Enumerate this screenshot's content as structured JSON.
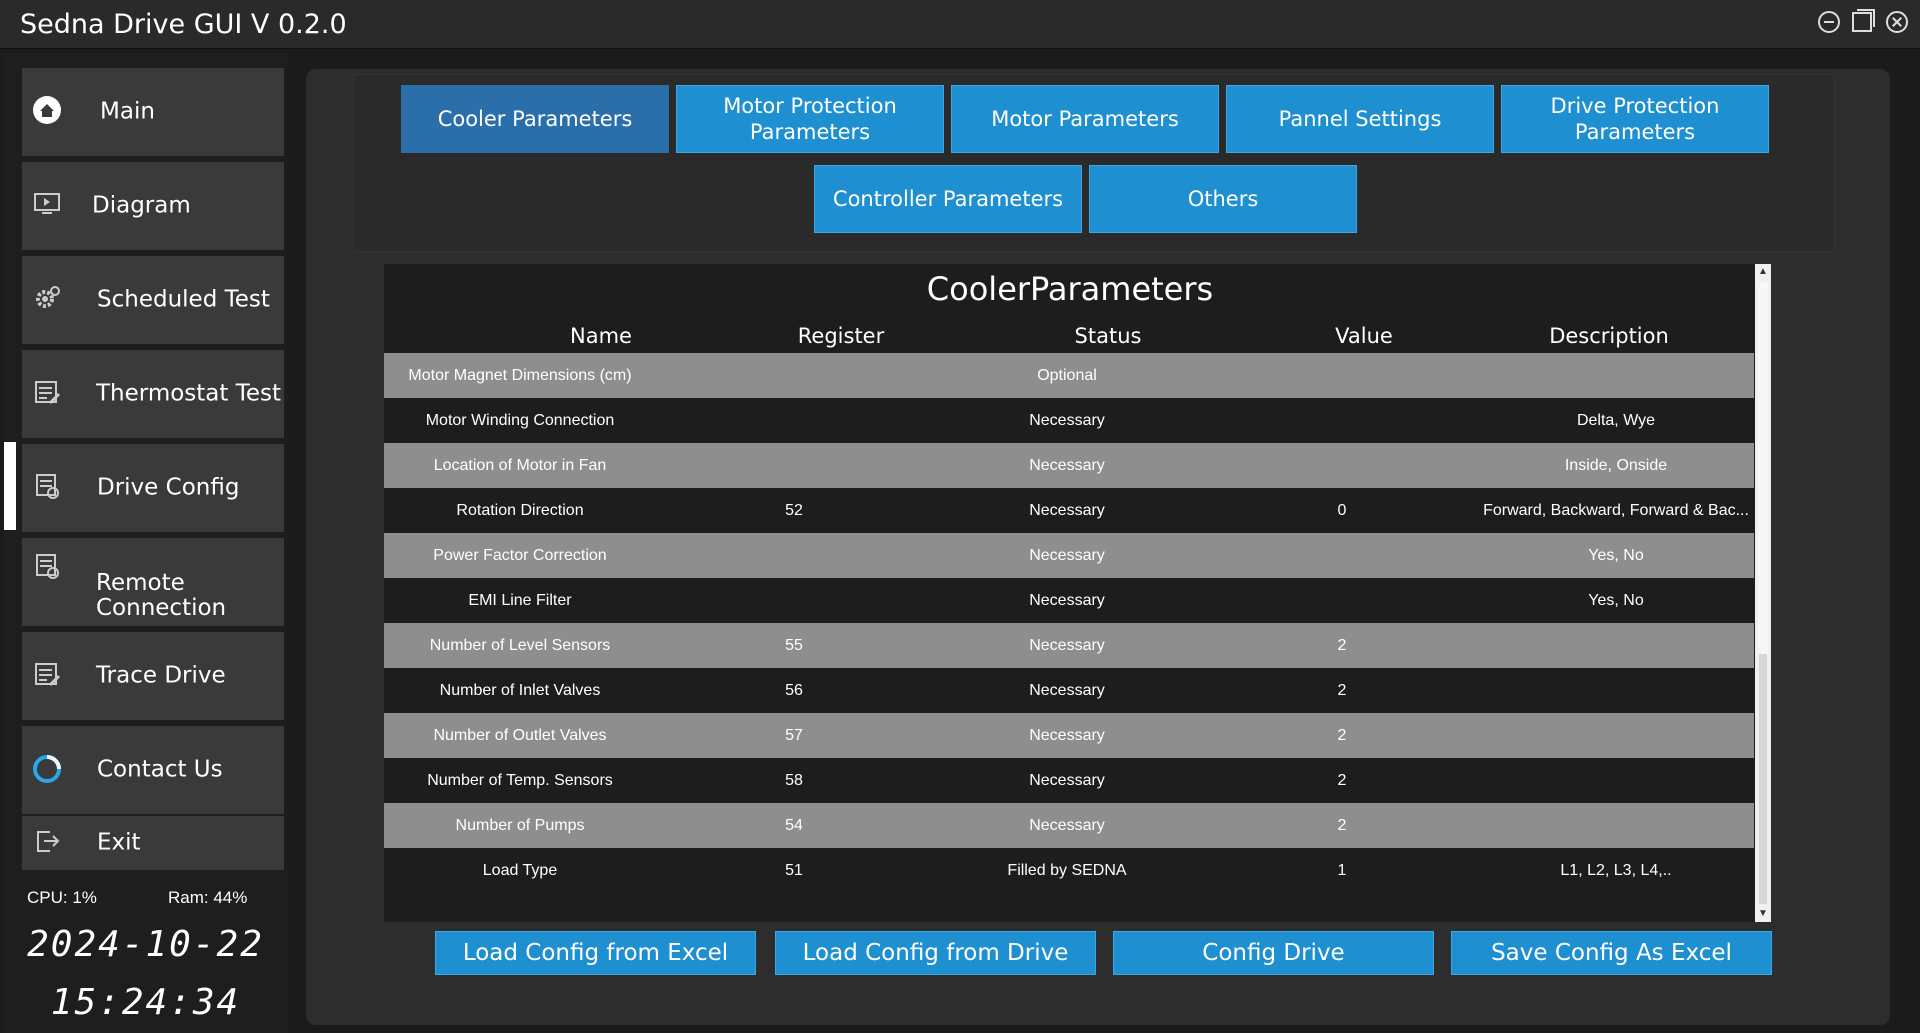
{
  "window": {
    "title": "Sedna Drive GUI V 0.2.0",
    "controls": [
      "minimize-icon",
      "restore-icon",
      "close-icon"
    ]
  },
  "sidebar": {
    "items": [
      {
        "label": "Main",
        "icon": "home-icon"
      },
      {
        "label": "Diagram",
        "icon": "monitor-icon"
      },
      {
        "label": "Scheduled Test",
        "icon": "gear-icon"
      },
      {
        "label": "Thermostat  Test",
        "icon": "test-board-icon"
      },
      {
        "label": "Drive Config",
        "icon": "config-icon",
        "active": true
      },
      {
        "label": "Remote Connection",
        "icon": "remote-icon"
      },
      {
        "label": "Trace Drive",
        "icon": "trace-icon"
      },
      {
        "label": "Contact Us",
        "icon": "contact-ring-icon"
      },
      {
        "label": "Exit",
        "icon": "exit-icon"
      }
    ],
    "cpu": "CPU: 1%",
    "ram": "Ram: 44%",
    "date": "2024-10-22",
    "time": "15:24:34"
  },
  "tabs": [
    {
      "label": "Cooler Parameters",
      "selected": true
    },
    {
      "label": "Motor Protection Parameters"
    },
    {
      "label": "Motor Parameters"
    },
    {
      "label": "Pannel Settings"
    },
    {
      "label": "Drive Protection Parameters"
    },
    {
      "label": "Controller Parameters"
    },
    {
      "label": "Others"
    }
  ],
  "table": {
    "title": "CoolerParameters",
    "headers": {
      "name": "Name",
      "register": "Register",
      "status": "Status",
      "value": "Value",
      "description": "Description"
    },
    "rows": [
      {
        "name": "Motor Magnet Dimensions (cm)",
        "register": "",
        "status": "Optional",
        "value": "",
        "description": ""
      },
      {
        "name": "Motor Winding Connection",
        "register": "",
        "status": "Necessary",
        "value": "",
        "description": "Delta, Wye"
      },
      {
        "name": "Location of Motor in Fan",
        "register": "",
        "status": "Necessary",
        "value": "",
        "description": "Inside, Onside"
      },
      {
        "name": "Rotation Direction",
        "register": "52",
        "status": "Necessary",
        "value": "0",
        "description": "Forward, Backward, Forward & Bac..."
      },
      {
        "name": "Power Factor Correction",
        "register": "",
        "status": "Necessary",
        "value": "",
        "description": "Yes, No"
      },
      {
        "name": "EMI Line Filter",
        "register": "",
        "status": "Necessary",
        "value": "",
        "description": "Yes, No"
      },
      {
        "name": "Number of Level Sensors",
        "register": "55",
        "status": "Necessary",
        "value": "2",
        "description": ""
      },
      {
        "name": "Number of Inlet Valves",
        "register": "56",
        "status": "Necessary",
        "value": "2",
        "description": ""
      },
      {
        "name": "Number of Outlet Valves",
        "register": "57",
        "status": "Necessary",
        "value": "2",
        "description": ""
      },
      {
        "name": "Number of Temp. Sensors",
        "register": "58",
        "status": "Necessary",
        "value": "2",
        "description": ""
      },
      {
        "name": "Number of Pumps",
        "register": "54",
        "status": "Necessary",
        "value": "2",
        "description": ""
      },
      {
        "name": "Load Type",
        "register": "51",
        "status": "Filled by SEDNA",
        "value": "1",
        "description": "L1, L2, L3, L4,.."
      }
    ]
  },
  "actions": {
    "load_excel": "Load Config from Excel",
    "load_drive": "Load Config from Drive",
    "config_drive": "Config Drive",
    "save_excel": "Save Config As Excel"
  },
  "colors": {
    "accent": "#1e8fd0",
    "tab_selected": "#2a6eaa",
    "row_light": "#8e8e8e",
    "row_dark": "#1d1d1d"
  }
}
